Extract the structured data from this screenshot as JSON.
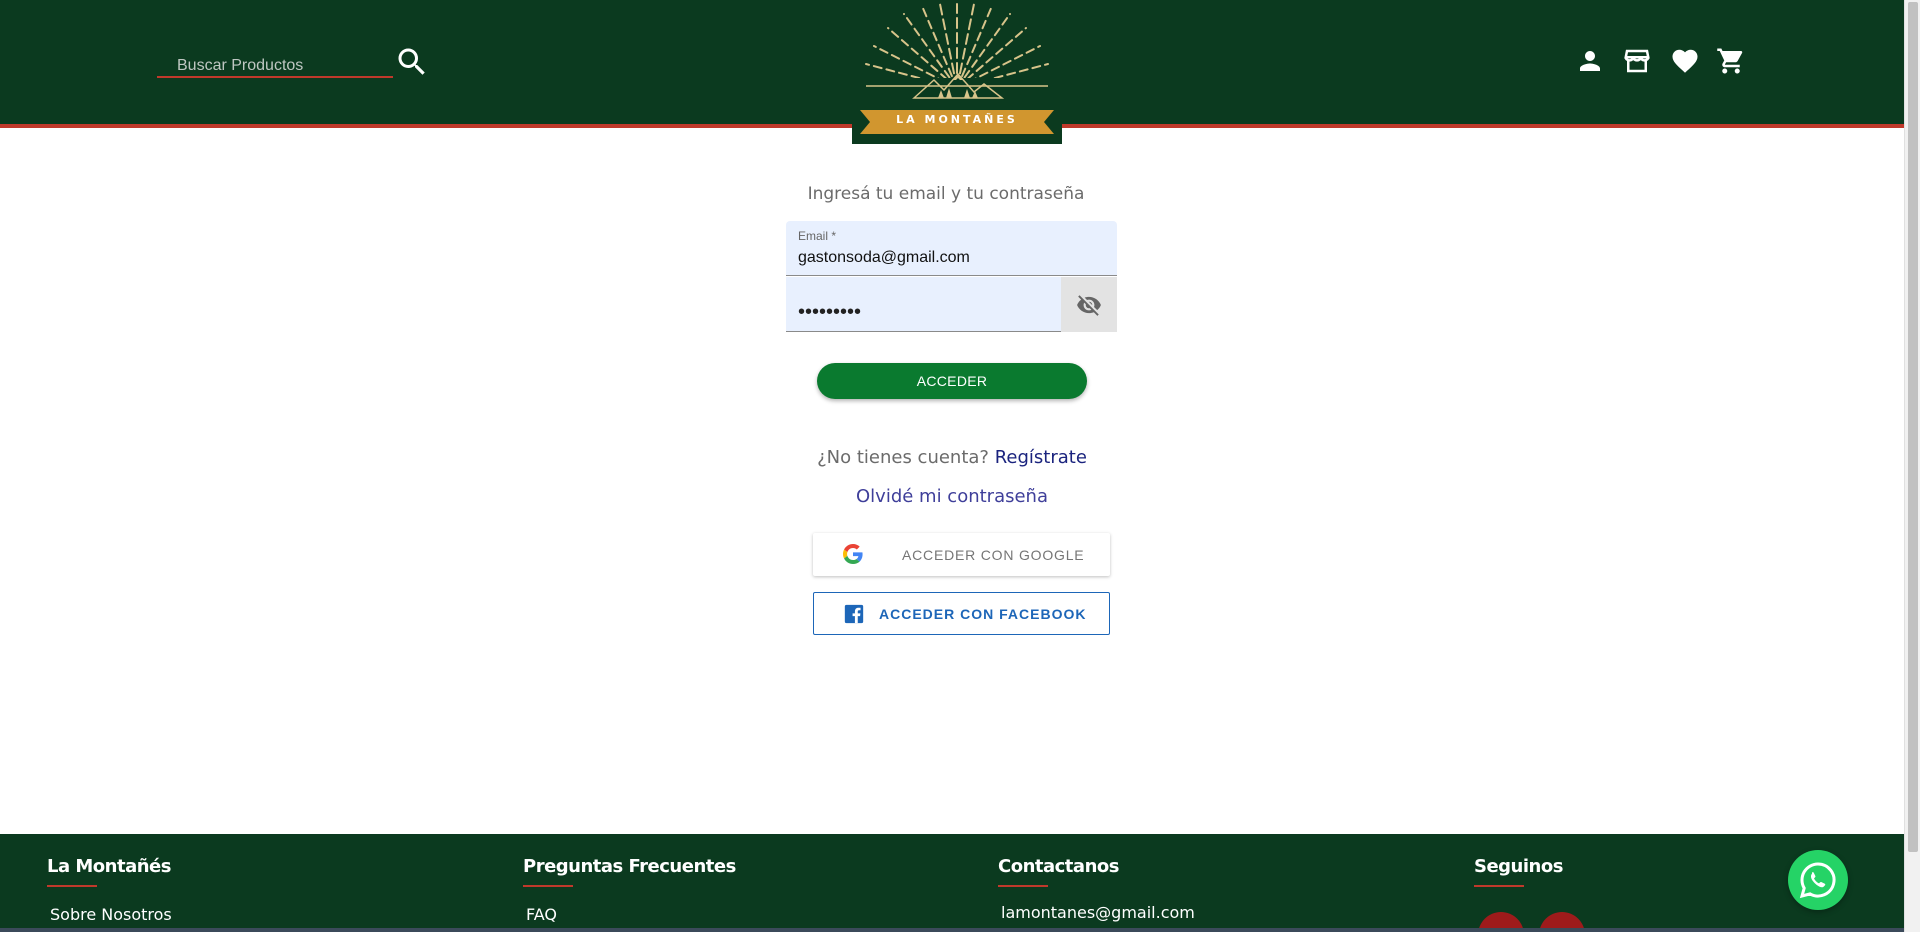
{
  "header": {
    "search_placeholder": "Buscar Productos",
    "logo_text": "LA MONTAÑES",
    "icons": [
      "account-icon",
      "store-icon",
      "heart-icon",
      "cart-icon"
    ]
  },
  "login": {
    "title": "Ingresá tu email y tu contraseña",
    "email_label": "Email *",
    "email_value": "gastonsoda@gmail.com",
    "password_value": "•••••••••",
    "submit_label": "ACCEDER",
    "no_account_text": "¿No tienes cuenta?",
    "register_link": "Regístrate",
    "forgot_link": "Olvidé mi contraseña",
    "google_label": "ACCEDER CON GOOGLE",
    "facebook_label": "ACCEDER CON FACEBOOK"
  },
  "footer": {
    "col1": {
      "title": "La Montañés",
      "link": "Sobre Nosotros"
    },
    "col2": {
      "title": "Preguntas Frecuentes",
      "link": "FAQ"
    },
    "col3": {
      "title": "Contactanos",
      "email": "lamontanes@gmail.com"
    },
    "col4": {
      "title": "Seguinos"
    }
  },
  "colors": {
    "header_bg": "#0b3a1f",
    "accent_red": "#c0392b",
    "button_green": "#0a7a2f",
    "logo_gold": "#d4a040"
  }
}
